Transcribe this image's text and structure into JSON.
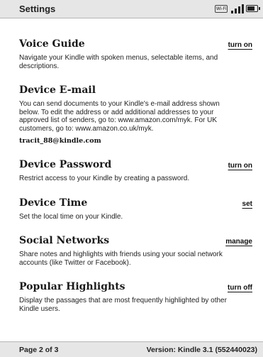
{
  "header": {
    "title": "Settings",
    "wifi_label": "Wi-Fi",
    "battery_level": 0.8
  },
  "sections": [
    {
      "title": "Voice Guide",
      "action": "turn on",
      "description": "Navigate your Kindle with spoken menus, selectable items, and descriptions."
    },
    {
      "title": "Device E-mail",
      "description": "You can send documents to your Kindle's e-mail address shown below. To edit the address or add additional addresses to your approved list of senders, go to: www.amazon.com/myk. For UK customers, go to: www.amazon.co.uk/myk.",
      "email": "tracit_88@kindle.com"
    },
    {
      "title": "Device Password",
      "action": "turn on",
      "description": "Restrict access to your Kindle by creating a password."
    },
    {
      "title": "Device Time",
      "action": "set",
      "description": "Set the local time on your Kindle."
    },
    {
      "title": "Social Networks",
      "action": "manage",
      "description": "Share notes and highlights with friends using your social network accounts (like Twitter or Facebook)."
    },
    {
      "title": "Popular Highlights",
      "action": "turn off",
      "description": "Display the passages that are most frequently highlighted by other Kindle users."
    }
  ],
  "footer": {
    "page": "Page 2 of 3",
    "version": "Version: Kindle 3.1 (552440023)"
  }
}
